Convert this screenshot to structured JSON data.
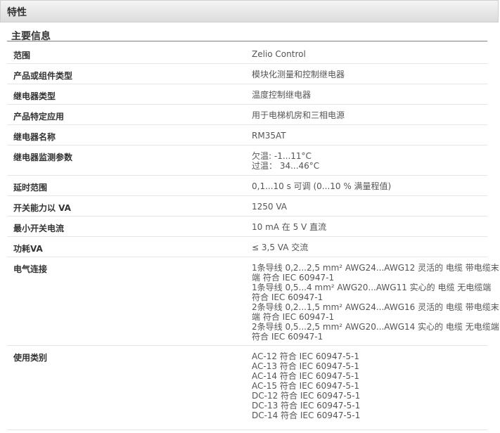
{
  "header": {
    "title": "特性"
  },
  "section": {
    "title": "主要信息"
  },
  "rows": [
    {
      "label": "范围",
      "value": [
        "Zelio Control"
      ]
    },
    {
      "label": "产品或组件类型",
      "value": [
        "模块化测量和控制继电器"
      ]
    },
    {
      "label": "继电器类型",
      "value": [
        "温度控制继电器"
      ]
    },
    {
      "label": "产品特定应用",
      "value": [
        "用于电梯机房和三相电源"
      ]
    },
    {
      "label": "继电器名称",
      "value": [
        "RM35AT"
      ]
    },
    {
      "label": "继电器监测参数",
      "value": [
        "欠温: -1...11°C",
        "过温： 34...46°C"
      ]
    },
    {
      "label": "延时范围",
      "value": [
        "0,1...10 s 可调 (0...10 % 满量程值)"
      ]
    },
    {
      "label": "开关能力以 VA",
      "value": [
        "1250 VA"
      ]
    },
    {
      "label": "最小开关电流",
      "value": [
        "10 mA 在 5 V 直流"
      ]
    },
    {
      "label": "功耗VA",
      "value": [
        "≤ 3,5 VA 交流"
      ]
    },
    {
      "label": "电气连接",
      "value": [
        "1条导线 0,2...2,5 mm² AWG24...AWG12 灵活的 电缆 带电缆末",
        "端 符合 IEC 60947-1",
        "1条导线 0,5...4 mm² AWG20...AWG11 实心的 电缆 无电缆端",
        "符合 IEC 60947-1",
        "2条导线 0,2...1,5 mm² AWG24...AWG16 灵活的 电缆 带电缆末",
        "端 符合 IEC 60947-1",
        "2条导线 0,5...2,5 mm² AWG20...AWG14 实心的 电缆 无电缆端",
        "符合 IEC 60947-1"
      ]
    },
    {
      "label": "使用类别",
      "value": [
        "AC-12 符合 IEC 60947-5-1",
        "AC-13 符合 IEC 60947-5-1",
        "AC-14 符合 IEC 60947-5-1",
        "AC-15 符合 IEC 60947-5-1",
        "DC-12 符合 IEC 60947-5-1",
        "DC-13 符合 IEC 60947-5-1",
        "DC-14 符合 IEC 60947-5-1"
      ]
    }
  ]
}
